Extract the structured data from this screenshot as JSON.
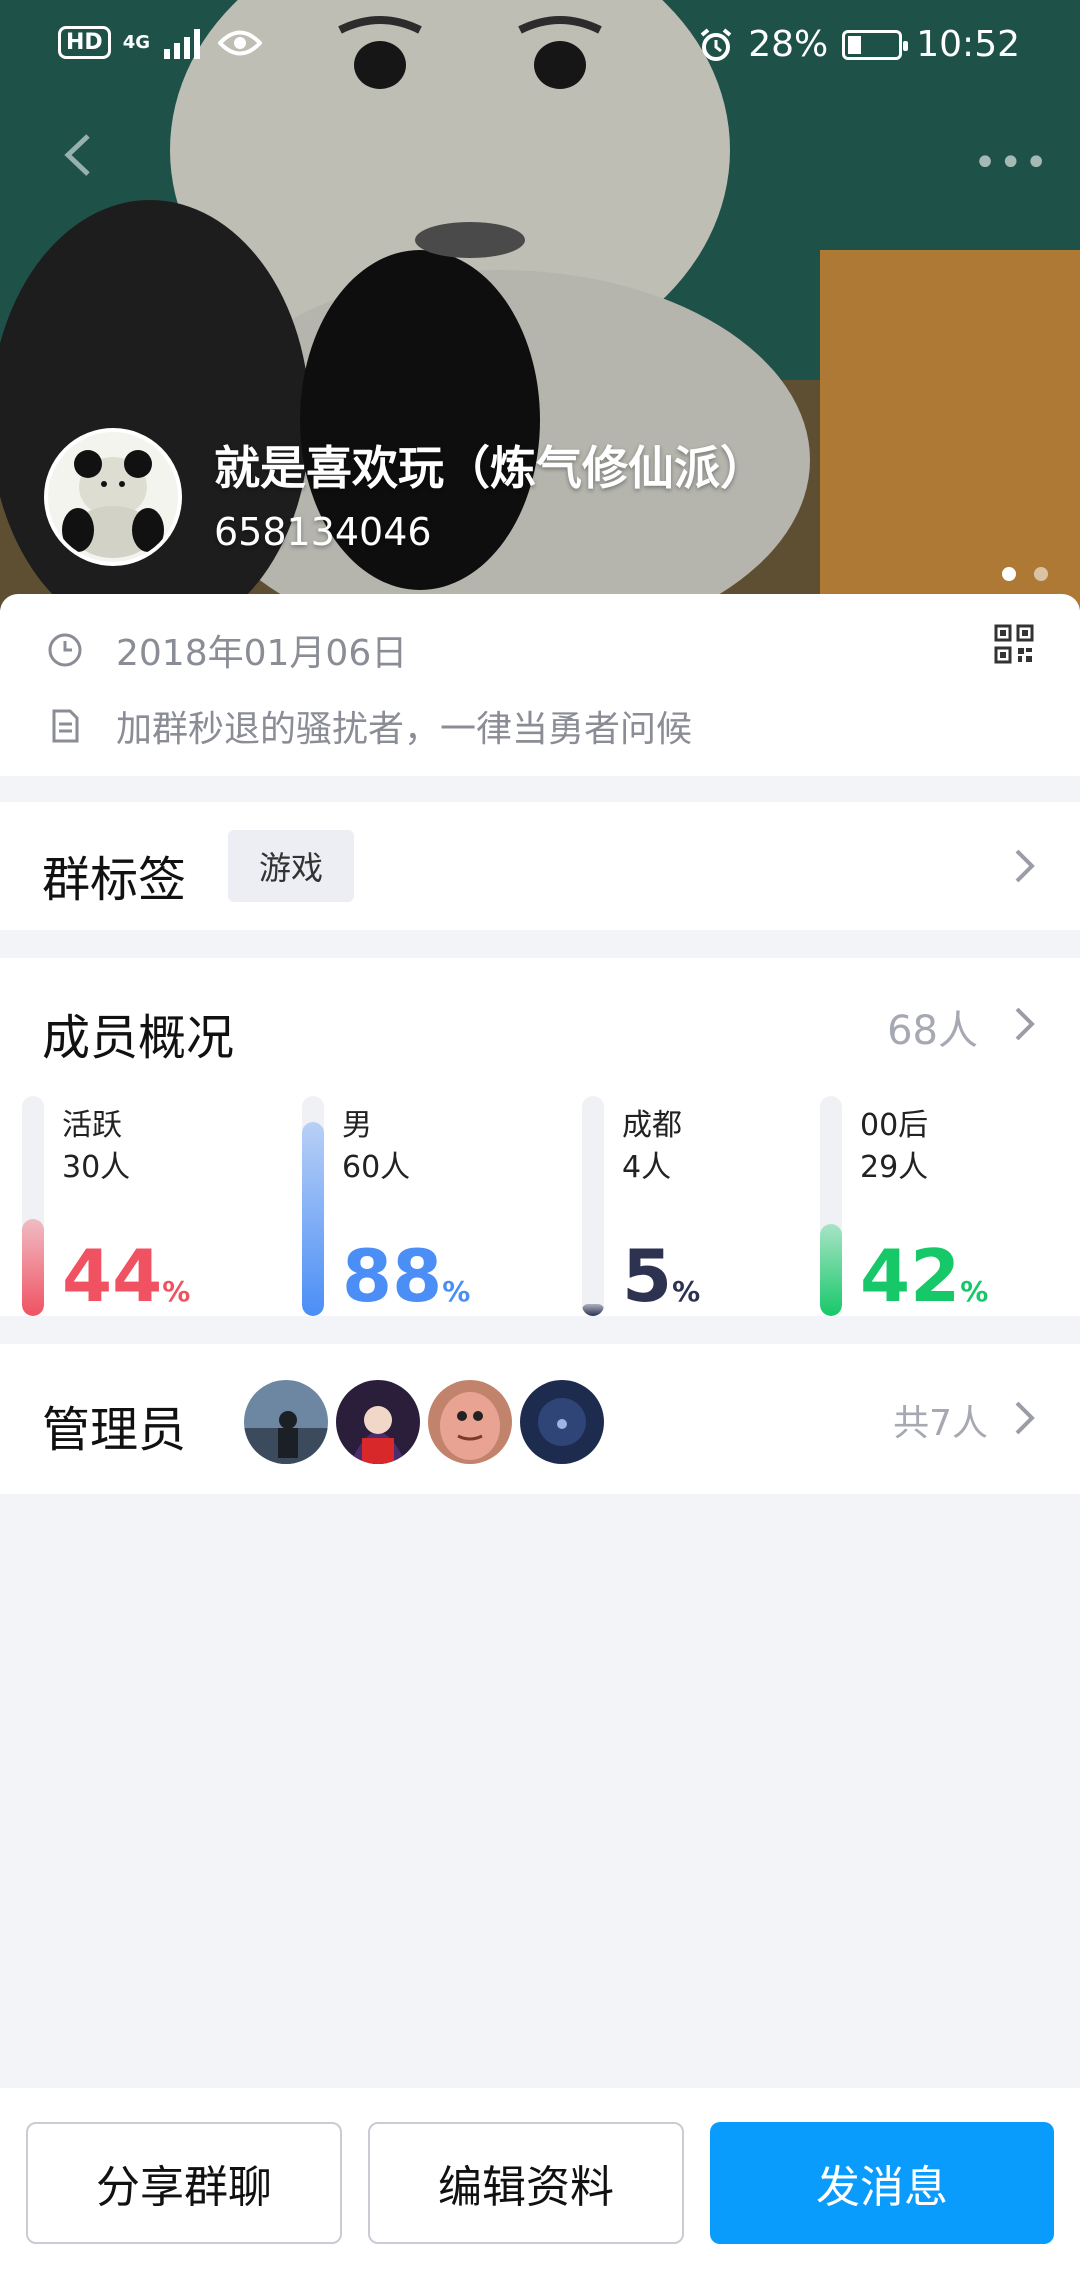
{
  "status_bar": {
    "hd_label": "HD",
    "network_label": "4G",
    "battery_percent": "28%",
    "battery_level": 0.28,
    "time": "10:52",
    "icons": [
      "signal-icon",
      "eye-icon",
      "alarm-icon",
      "battery-icon"
    ]
  },
  "header": {
    "group_name": "就是喜欢玩（炼气修仙派）",
    "group_id": "658134046",
    "carousel_pages": 2,
    "carousel_active": 0
  },
  "info": {
    "created_date": "2018年01月06日",
    "description": "加群秒退的骚扰者，一律当勇者问候"
  },
  "tags": {
    "title": "群标签",
    "items": [
      "游戏"
    ]
  },
  "members": {
    "title": "成员概况",
    "count": "68人",
    "stats": [
      {
        "label": "活跃",
        "count": "30人",
        "percent": "44",
        "sign": "%",
        "level": 0.44,
        "color": "#f05262"
      },
      {
        "label": "男",
        "count": "60人",
        "percent": "88",
        "sign": "%",
        "level": 0.88,
        "color": "#4a8ef6"
      },
      {
        "label": "成都",
        "count": "4人",
        "percent": "5",
        "sign": "%",
        "level": 0.05,
        "color": "#2c3250"
      },
      {
        "label": "00后",
        "count": "29人",
        "percent": "42",
        "sign": "%",
        "level": 0.42,
        "color": "#17c869"
      }
    ]
  },
  "admins": {
    "title": "管理员",
    "total": "共7人"
  },
  "actions": {
    "share": "分享群聊",
    "edit": "编辑资料",
    "send": "发消息"
  },
  "colors": {
    "accent": "#0a9cfd",
    "background": "#f3f4f7"
  }
}
